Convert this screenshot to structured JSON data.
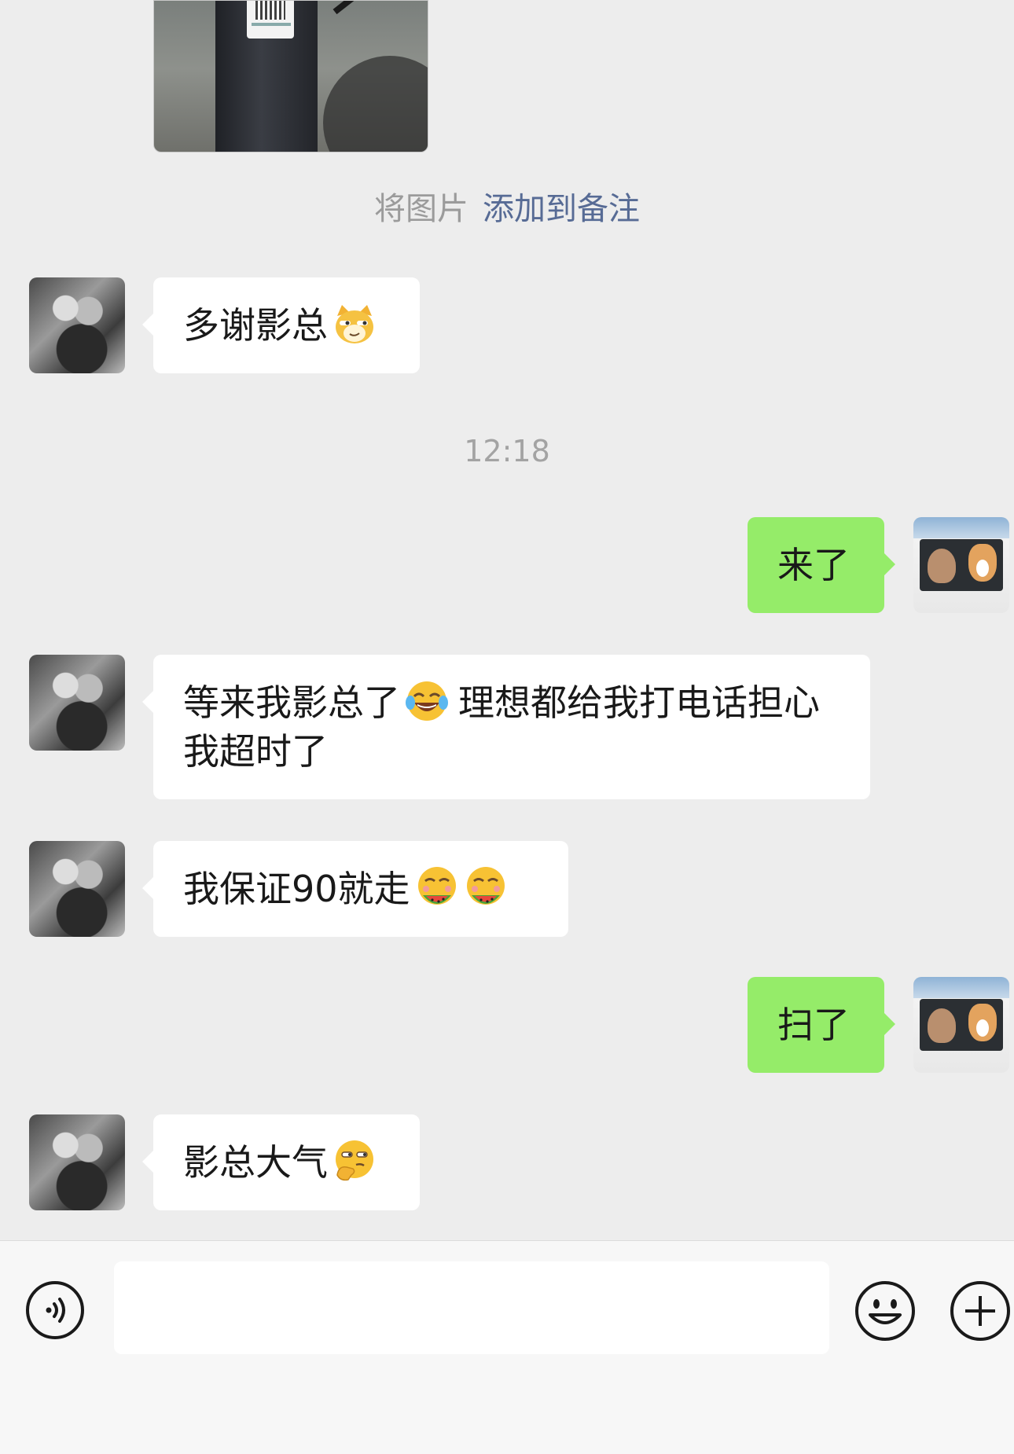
{
  "system_note": {
    "prefix": "将图片",
    "link": "添加到备注"
  },
  "timestamp": "12:18",
  "messages": [
    {
      "side": "left",
      "text": "多谢影总",
      "emoji": "cat-smirk-emoji"
    },
    {
      "side": "right",
      "text": "来了"
    },
    {
      "side": "left",
      "text_part1": "等来我影总了",
      "emoji": "tears-of-joy-emoji",
      "text_part2": "理想都给我打电话担心我超时了"
    },
    {
      "side": "left",
      "text": "我保证90就走",
      "emoji": "eating-watermelon-emoji"
    },
    {
      "side": "right",
      "text": "扫了"
    },
    {
      "side": "left",
      "text": "影总大气",
      "emoji": "thinking-smirk-emoji"
    }
  ],
  "input_bar": {
    "placeholder": "",
    "voice_icon": "voice-icon",
    "emoji_icon": "smiley-icon",
    "plus_icon": "plus-icon"
  },
  "colors": {
    "chat_bg": "#ededed",
    "self_bubble": "#95ec69",
    "other_bubble": "#ffffff",
    "link": "#576b95",
    "timestamp": "#a3a3a3"
  }
}
